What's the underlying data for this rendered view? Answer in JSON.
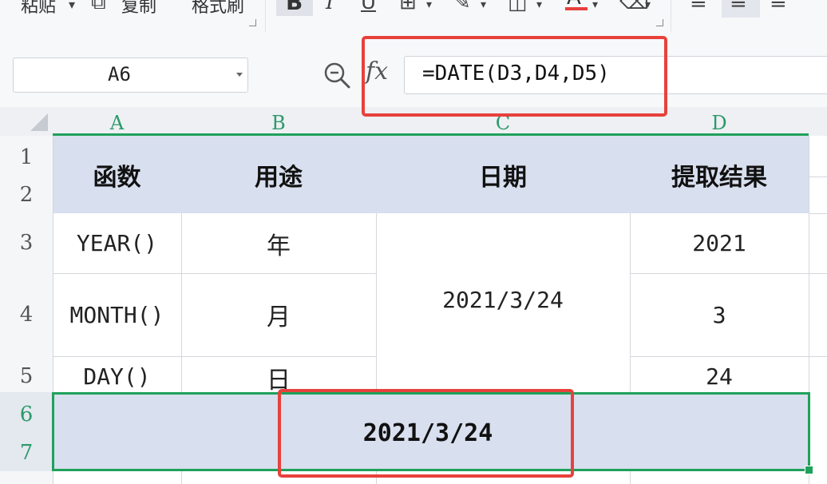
{
  "toolbar": {
    "paste_label": "粘贴",
    "copy_label": "复制",
    "format_painter_label": "格式刷",
    "bold_glyph": "B",
    "italic_glyph": "I",
    "underline_glyph": "U",
    "font_color_glyph": "A"
  },
  "formula_bar": {
    "name_box_value": "A6",
    "formula": "=DATE(D3,D4,D5)",
    "fx_symbol": "fx"
  },
  "columns": [
    "A",
    "B",
    "C",
    "D"
  ],
  "rows": [
    "1",
    "2",
    "3",
    "4",
    "5",
    "6",
    "7"
  ],
  "table": {
    "headers": [
      "函数",
      "用途",
      "日期",
      "提取结果"
    ],
    "functions": [
      "YEAR()",
      "MONTH()",
      "DAY()"
    ],
    "uses": [
      "年",
      "月",
      "日"
    ],
    "date": "2021/3/24",
    "results": [
      "2021",
      "3",
      "24"
    ]
  },
  "merged_result": "2021/3/24",
  "colors": {
    "selection_green": "#1fa15b",
    "highlight_red": "#e8413c",
    "header_fill": "#d8dfee"
  },
  "icons": [
    "copy-icon",
    "bold-icon",
    "italic-icon",
    "underline-icon",
    "border-icon",
    "paint-brush-icon",
    "fill-color-icon",
    "font-color-icon",
    "eraser-icon",
    "align-left-icon",
    "align-center-icon",
    "align-right-icon",
    "zoom-icon",
    "fx-icon"
  ]
}
